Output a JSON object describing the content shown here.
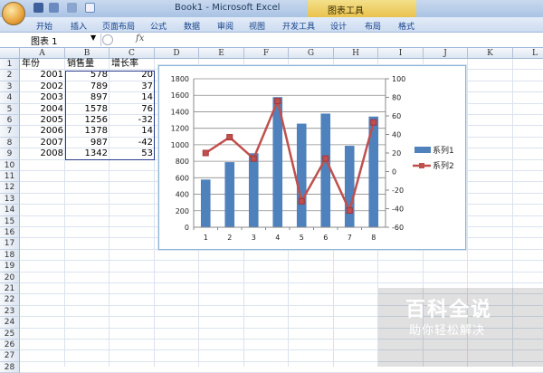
{
  "window": {
    "title": "Book1 - Microsoft Excel",
    "context_tab": "图表工具"
  },
  "ribbon": {
    "tabs": [
      "开始",
      "插入",
      "页面布局",
      "公式",
      "数据",
      "审阅",
      "视图",
      "开发工具",
      "设计",
      "布局",
      "格式"
    ]
  },
  "formula_bar": {
    "name_box": "图表 1",
    "fx": "fx",
    "value": ""
  },
  "columns": [
    "A",
    "B",
    "C",
    "D",
    "E",
    "F",
    "G",
    "H",
    "I",
    "J",
    "K",
    "L"
  ],
  "rows": [
    "1",
    "2",
    "3",
    "4",
    "5",
    "6",
    "7",
    "8",
    "9",
    "10",
    "11",
    "12",
    "13",
    "14",
    "15",
    "16",
    "17",
    "18",
    "19",
    "20",
    "21",
    "22",
    "23",
    "24",
    "25",
    "26",
    "27",
    "28"
  ],
  "table": {
    "headers": [
      "年份",
      "销售量",
      "增长率"
    ],
    "rows": [
      [
        "2001",
        "578",
        "20"
      ],
      [
        "2002",
        "789",
        "37"
      ],
      [
        "2003",
        "897",
        "14"
      ],
      [
        "2004",
        "1578",
        "76"
      ],
      [
        "2005",
        "1256",
        "-32"
      ],
      [
        "2006",
        "1378",
        "14"
      ],
      [
        "2007",
        "987",
        "-42"
      ],
      [
        "2008",
        "1342",
        "53"
      ]
    ]
  },
  "chart_data": {
    "type": "bar",
    "categories": [
      "1",
      "2",
      "3",
      "4",
      "5",
      "6",
      "7",
      "8"
    ],
    "series": [
      {
        "name": "系列1",
        "kind": "bar",
        "axis": "left",
        "values": [
          578,
          789,
          897,
          1578,
          1256,
          1378,
          987,
          1342
        ],
        "color": "#4f81bd"
      },
      {
        "name": "系列2",
        "kind": "line",
        "axis": "right",
        "values": [
          20,
          37,
          14,
          76,
          -32,
          14,
          -42,
          53
        ],
        "color": "#c0504d"
      }
    ],
    "y_left": {
      "range": [
        0,
        1800
      ],
      "ticks": [
        "0",
        "200",
        "400",
        "600",
        "800",
        "1000",
        "1200",
        "1400",
        "1600",
        "1800"
      ]
    },
    "y_right": {
      "range": [
        -60,
        100
      ],
      "ticks": [
        "-60",
        "-40",
        "-20",
        "0",
        "20",
        "40",
        "60",
        "80",
        "100"
      ]
    },
    "grid": true,
    "legend": "right"
  },
  "watermark": {
    "line1": "百科全说",
    "line2": "助你轻松解决"
  }
}
